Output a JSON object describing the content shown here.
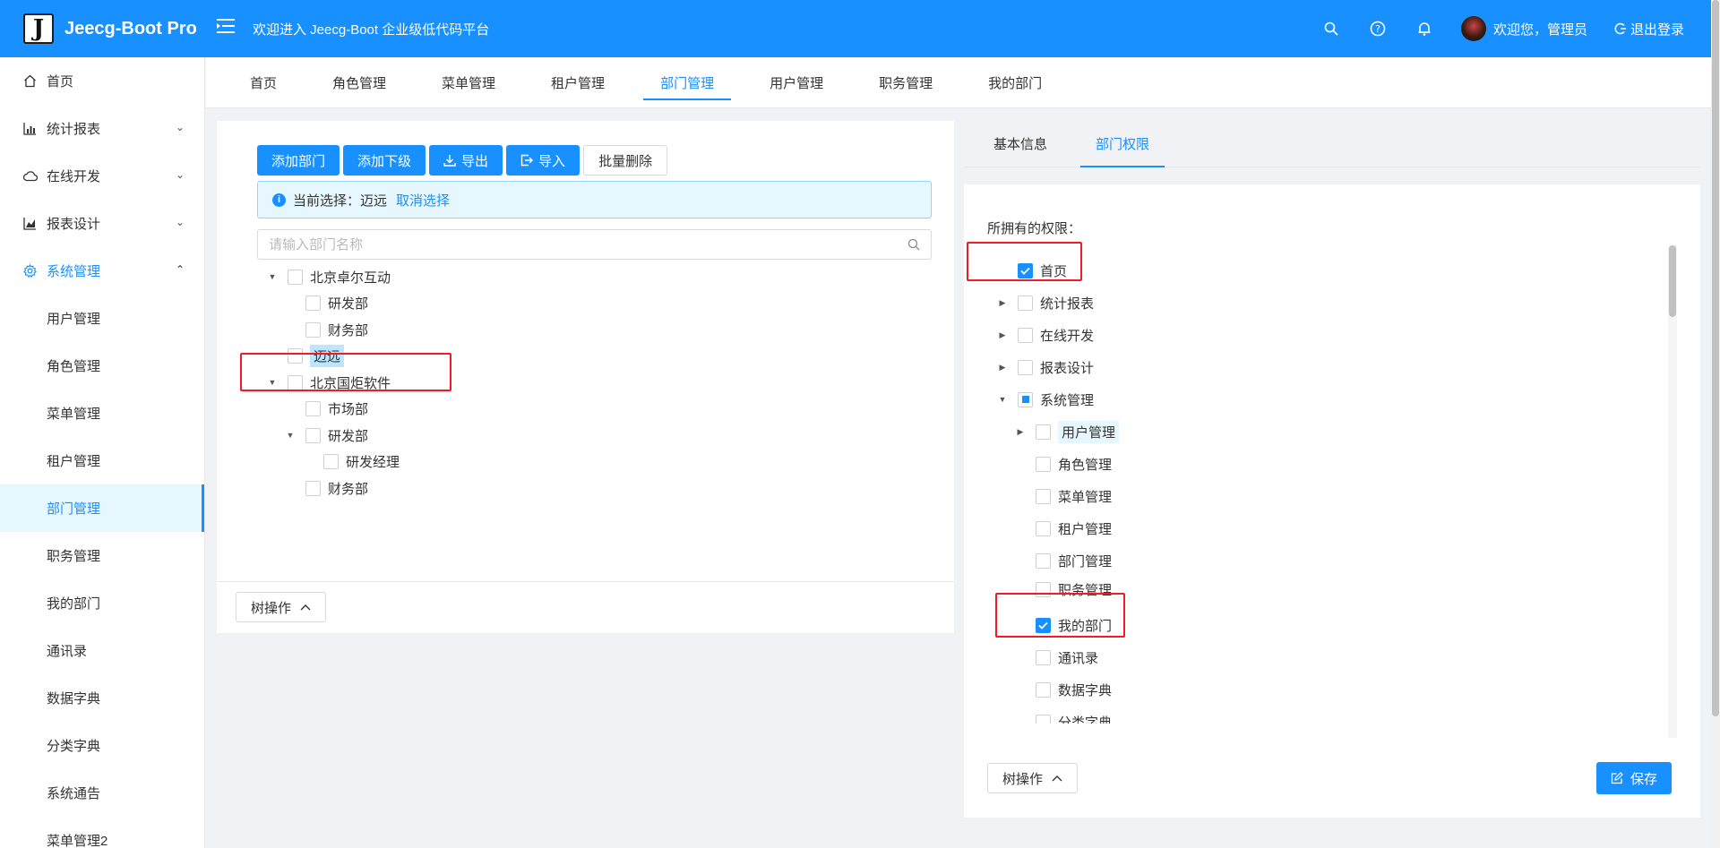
{
  "header": {
    "logo_letter": "J",
    "app_name": "Jeecg-Boot Pro",
    "welcome": "欢迎进入 Jeecg-Boot 企业级低代码平台",
    "user_greeting": "欢迎您，管理员",
    "logout": "退出登录"
  },
  "sidebar": {
    "items": [
      {
        "label": "首页",
        "icon": "home-icon"
      },
      {
        "label": "统计报表",
        "icon": "bar-chart-icon"
      },
      {
        "label": "在线开发",
        "icon": "cloud-icon"
      },
      {
        "label": "报表设计",
        "icon": "area-chart-icon"
      },
      {
        "label": "系统管理",
        "icon": "gear-icon"
      }
    ],
    "sub_items": [
      "用户管理",
      "角色管理",
      "菜单管理",
      "租户管理",
      "部门管理",
      "职务管理",
      "我的部门",
      "通讯录",
      "数据字典",
      "分类字典",
      "系统通告",
      "菜单管理2"
    ]
  },
  "tabs": [
    "首页",
    "角色管理",
    "菜单管理",
    "租户管理",
    "部门管理",
    "用户管理",
    "职务管理",
    "我的部门"
  ],
  "left": {
    "buttons": [
      "添加部门",
      "添加下级",
      "导出",
      "导入",
      "批量删除"
    ],
    "alert_prefix": "当前选择：",
    "alert_value": "迈远",
    "alert_link": "取消选择",
    "search_placeholder": "请输入部门名称",
    "tree": [
      "北京卓尔互动",
      "研发部",
      "财务部",
      "迈远",
      "北京国炬软件",
      "市场部",
      "研发部",
      "研发经理",
      "财务部"
    ],
    "tree_op": "树操作"
  },
  "right": {
    "tabs": [
      "基本信息",
      "部门权限"
    ],
    "perm_title": "所拥有的权限：",
    "tree": [
      "首页",
      "统计报表",
      "在线开发",
      "报表设计",
      "系统管理",
      "用户管理",
      "角色管理",
      "菜单管理",
      "租户管理",
      "部门管理",
      "职务管理",
      "我的部门",
      "通讯录",
      "数据字典",
      "分类字典"
    ],
    "tree_op": "树操作",
    "save": "保存"
  },
  "colors": {
    "primary": "#1890ff",
    "highlight": "#ef1c24"
  }
}
